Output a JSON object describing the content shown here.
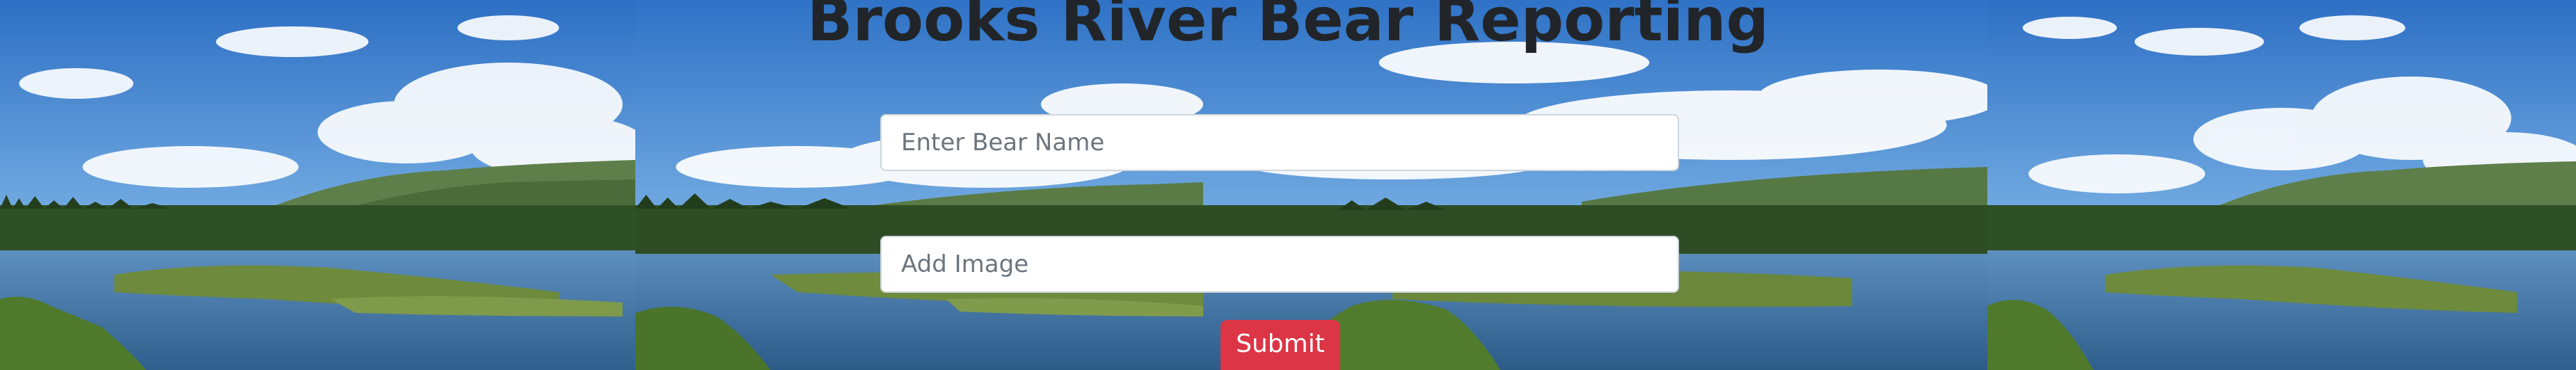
{
  "page": {
    "title": "Brooks River Bear Reporting"
  },
  "form": {
    "bear_name": {
      "placeholder": "Enter Bear Name",
      "value": ""
    },
    "image": {
      "placeholder": "Add Image",
      "value": ""
    },
    "submit_label": "Submit"
  },
  "colors": {
    "title_text": "#212529",
    "submit_bg": "#dc3545",
    "input_border": "#ced4da",
    "sky": "#3a7fd0",
    "water": "#3c6e9a"
  }
}
